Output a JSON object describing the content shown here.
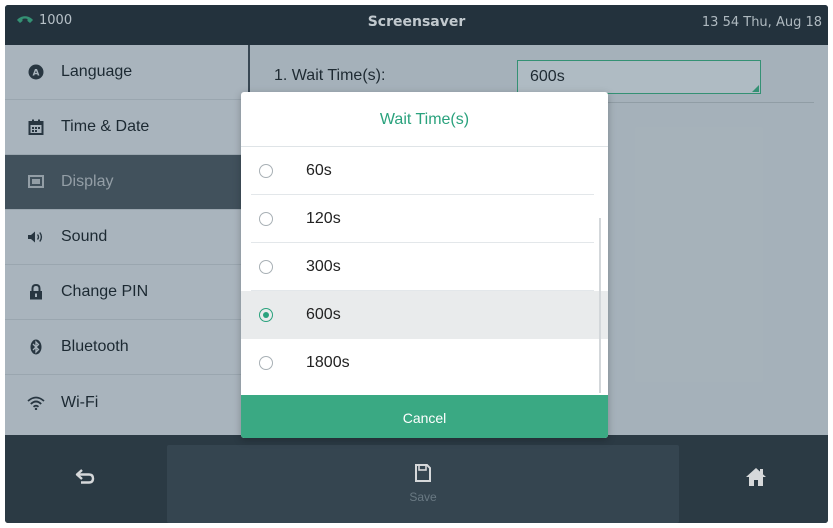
{
  "status": {
    "line": "1000",
    "title": "Screensaver",
    "datetime": "13 54 Thu, Aug 18"
  },
  "menu": {
    "items": [
      {
        "label": "Language",
        "icon": "language-icon"
      },
      {
        "label": "Time & Date",
        "icon": "calendar-icon"
      },
      {
        "label": "Display",
        "icon": "display-icon",
        "active": true
      },
      {
        "label": "Sound",
        "icon": "speaker-icon"
      },
      {
        "label": "Change PIN",
        "icon": "lock-icon"
      },
      {
        "label": "Bluetooth",
        "icon": "bluetooth-icon"
      },
      {
        "label": "Wi-Fi",
        "icon": "wifi-icon"
      }
    ]
  },
  "setting": {
    "label": "1. Wait Time(s):",
    "value": "600s"
  },
  "dialog": {
    "title": "Wait Time(s)",
    "options": [
      {
        "label": "60s",
        "selected": false
      },
      {
        "label": "120s",
        "selected": false
      },
      {
        "label": "300s",
        "selected": false
      },
      {
        "label": "600s",
        "selected": true
      },
      {
        "label": "1800s",
        "selected": false
      }
    ],
    "cancel_label": "Cancel"
  },
  "bottom": {
    "save_label": "Save"
  },
  "colors": {
    "accent": "#3aa983",
    "accent_text": "#2aa27d",
    "status_bar": "#253540",
    "menu_bg": "#c8d4dc",
    "menu_active": "#4a5b66",
    "bottom_bar": "#2f3f49"
  }
}
